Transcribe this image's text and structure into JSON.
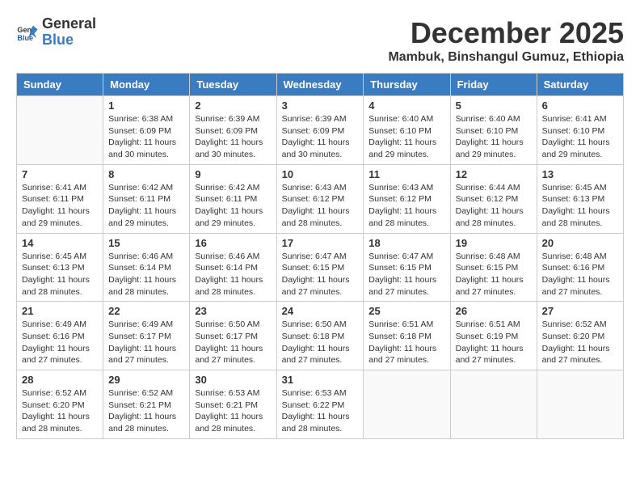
{
  "logo": {
    "line1": "General",
    "line2": "Blue"
  },
  "title": "December 2025",
  "location": "Mambuk, Binshangul Gumuz, Ethiopia",
  "days_of_week": [
    "Sunday",
    "Monday",
    "Tuesday",
    "Wednesday",
    "Thursday",
    "Friday",
    "Saturday"
  ],
  "weeks": [
    [
      {
        "day": "",
        "sunrise": "",
        "sunset": "",
        "daylight": ""
      },
      {
        "day": "1",
        "sunrise": "Sunrise: 6:38 AM",
        "sunset": "Sunset: 6:09 PM",
        "daylight": "Daylight: 11 hours and 30 minutes."
      },
      {
        "day": "2",
        "sunrise": "Sunrise: 6:39 AM",
        "sunset": "Sunset: 6:09 PM",
        "daylight": "Daylight: 11 hours and 30 minutes."
      },
      {
        "day": "3",
        "sunrise": "Sunrise: 6:39 AM",
        "sunset": "Sunset: 6:09 PM",
        "daylight": "Daylight: 11 hours and 30 minutes."
      },
      {
        "day": "4",
        "sunrise": "Sunrise: 6:40 AM",
        "sunset": "Sunset: 6:10 PM",
        "daylight": "Daylight: 11 hours and 29 minutes."
      },
      {
        "day": "5",
        "sunrise": "Sunrise: 6:40 AM",
        "sunset": "Sunset: 6:10 PM",
        "daylight": "Daylight: 11 hours and 29 minutes."
      },
      {
        "day": "6",
        "sunrise": "Sunrise: 6:41 AM",
        "sunset": "Sunset: 6:10 PM",
        "daylight": "Daylight: 11 hours and 29 minutes."
      }
    ],
    [
      {
        "day": "7",
        "sunrise": "Sunrise: 6:41 AM",
        "sunset": "Sunset: 6:11 PM",
        "daylight": "Daylight: 11 hours and 29 minutes."
      },
      {
        "day": "8",
        "sunrise": "Sunrise: 6:42 AM",
        "sunset": "Sunset: 6:11 PM",
        "daylight": "Daylight: 11 hours and 29 minutes."
      },
      {
        "day": "9",
        "sunrise": "Sunrise: 6:42 AM",
        "sunset": "Sunset: 6:11 PM",
        "daylight": "Daylight: 11 hours and 29 minutes."
      },
      {
        "day": "10",
        "sunrise": "Sunrise: 6:43 AM",
        "sunset": "Sunset: 6:12 PM",
        "daylight": "Daylight: 11 hours and 28 minutes."
      },
      {
        "day": "11",
        "sunrise": "Sunrise: 6:43 AM",
        "sunset": "Sunset: 6:12 PM",
        "daylight": "Daylight: 11 hours and 28 minutes."
      },
      {
        "day": "12",
        "sunrise": "Sunrise: 6:44 AM",
        "sunset": "Sunset: 6:12 PM",
        "daylight": "Daylight: 11 hours and 28 minutes."
      },
      {
        "day": "13",
        "sunrise": "Sunrise: 6:45 AM",
        "sunset": "Sunset: 6:13 PM",
        "daylight": "Daylight: 11 hours and 28 minutes."
      }
    ],
    [
      {
        "day": "14",
        "sunrise": "Sunrise: 6:45 AM",
        "sunset": "Sunset: 6:13 PM",
        "daylight": "Daylight: 11 hours and 28 minutes."
      },
      {
        "day": "15",
        "sunrise": "Sunrise: 6:46 AM",
        "sunset": "Sunset: 6:14 PM",
        "daylight": "Daylight: 11 hours and 28 minutes."
      },
      {
        "day": "16",
        "sunrise": "Sunrise: 6:46 AM",
        "sunset": "Sunset: 6:14 PM",
        "daylight": "Daylight: 11 hours and 28 minutes."
      },
      {
        "day": "17",
        "sunrise": "Sunrise: 6:47 AM",
        "sunset": "Sunset: 6:15 PM",
        "daylight": "Daylight: 11 hours and 27 minutes."
      },
      {
        "day": "18",
        "sunrise": "Sunrise: 6:47 AM",
        "sunset": "Sunset: 6:15 PM",
        "daylight": "Daylight: 11 hours and 27 minutes."
      },
      {
        "day": "19",
        "sunrise": "Sunrise: 6:48 AM",
        "sunset": "Sunset: 6:15 PM",
        "daylight": "Daylight: 11 hours and 27 minutes."
      },
      {
        "day": "20",
        "sunrise": "Sunrise: 6:48 AM",
        "sunset": "Sunset: 6:16 PM",
        "daylight": "Daylight: 11 hours and 27 minutes."
      }
    ],
    [
      {
        "day": "21",
        "sunrise": "Sunrise: 6:49 AM",
        "sunset": "Sunset: 6:16 PM",
        "daylight": "Daylight: 11 hours and 27 minutes."
      },
      {
        "day": "22",
        "sunrise": "Sunrise: 6:49 AM",
        "sunset": "Sunset: 6:17 PM",
        "daylight": "Daylight: 11 hours and 27 minutes."
      },
      {
        "day": "23",
        "sunrise": "Sunrise: 6:50 AM",
        "sunset": "Sunset: 6:17 PM",
        "daylight": "Daylight: 11 hours and 27 minutes."
      },
      {
        "day": "24",
        "sunrise": "Sunrise: 6:50 AM",
        "sunset": "Sunset: 6:18 PM",
        "daylight": "Daylight: 11 hours and 27 minutes."
      },
      {
        "day": "25",
        "sunrise": "Sunrise: 6:51 AM",
        "sunset": "Sunset: 6:18 PM",
        "daylight": "Daylight: 11 hours and 27 minutes."
      },
      {
        "day": "26",
        "sunrise": "Sunrise: 6:51 AM",
        "sunset": "Sunset: 6:19 PM",
        "daylight": "Daylight: 11 hours and 27 minutes."
      },
      {
        "day": "27",
        "sunrise": "Sunrise: 6:52 AM",
        "sunset": "Sunset: 6:20 PM",
        "daylight": "Daylight: 11 hours and 27 minutes."
      }
    ],
    [
      {
        "day": "28",
        "sunrise": "Sunrise: 6:52 AM",
        "sunset": "Sunset: 6:20 PM",
        "daylight": "Daylight: 11 hours and 28 minutes."
      },
      {
        "day": "29",
        "sunrise": "Sunrise: 6:52 AM",
        "sunset": "Sunset: 6:21 PM",
        "daylight": "Daylight: 11 hours and 28 minutes."
      },
      {
        "day": "30",
        "sunrise": "Sunrise: 6:53 AM",
        "sunset": "Sunset: 6:21 PM",
        "daylight": "Daylight: 11 hours and 28 minutes."
      },
      {
        "day": "31",
        "sunrise": "Sunrise: 6:53 AM",
        "sunset": "Sunset: 6:22 PM",
        "daylight": "Daylight: 11 hours and 28 minutes."
      },
      {
        "day": "",
        "sunrise": "",
        "sunset": "",
        "daylight": ""
      },
      {
        "day": "",
        "sunrise": "",
        "sunset": "",
        "daylight": ""
      },
      {
        "day": "",
        "sunrise": "",
        "sunset": "",
        "daylight": ""
      }
    ]
  ]
}
